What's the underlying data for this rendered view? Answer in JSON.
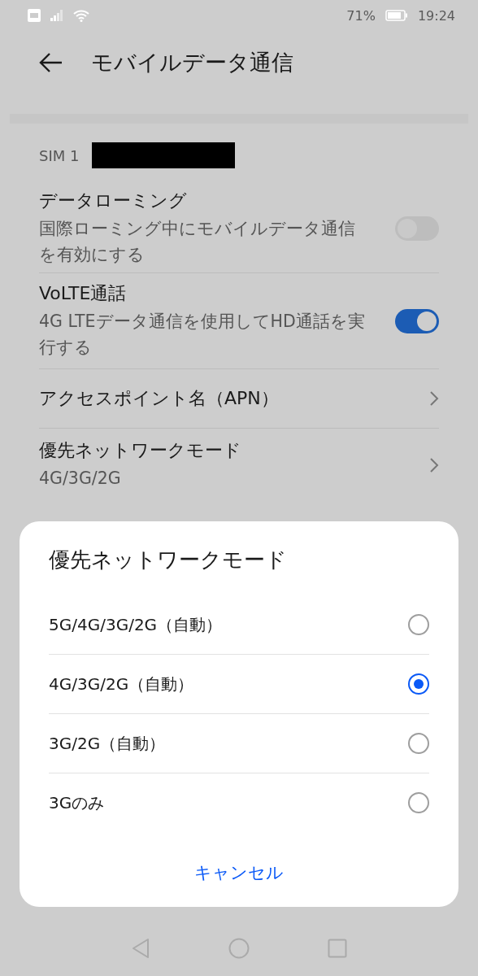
{
  "status_bar": {
    "battery_percent": "71%",
    "time": "19:24"
  },
  "header": {
    "title": "モバイルデータ通信"
  },
  "sim_label": "SIM 1",
  "settings": [
    {
      "kind": "toggle",
      "title": "データローミング",
      "subtitle": "国際ローミング中にモバイルデータ通信を有効にする",
      "on": false
    },
    {
      "kind": "toggle",
      "title": "VoLTE通話",
      "subtitle": "4G LTEデータ通信を使用してHD通話を実行する",
      "on": true
    },
    {
      "kind": "link",
      "title": "アクセスポイント名（APN）"
    },
    {
      "kind": "link",
      "title": "優先ネットワークモード",
      "subtitle": "4G/3G/2G"
    }
  ],
  "dialog": {
    "title": "優先ネットワークモード",
    "options": [
      {
        "label": "5G/4G/3G/2G（自動）",
        "selected": false
      },
      {
        "label": "4G/3G/2G（自動）",
        "selected": true
      },
      {
        "label": "3G/2G（自動）",
        "selected": false
      },
      {
        "label": "3Gのみ",
        "selected": false
      }
    ],
    "cancel": "キャンセル"
  }
}
